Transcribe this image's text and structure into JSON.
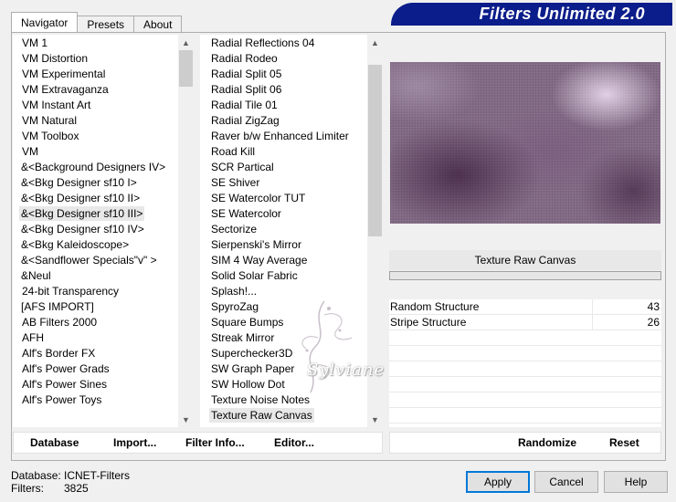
{
  "app_title": "Filters Unlimited 2.0",
  "tabs": [
    {
      "label": "Navigator",
      "active": true
    },
    {
      "label": "Presets",
      "active": false
    },
    {
      "label": "About",
      "active": false
    }
  ],
  "categories": [
    "VM 1",
    "VM Distortion",
    "VM Experimental",
    "VM Extravaganza",
    "VM Instant Art",
    "VM Natural",
    "VM Toolbox",
    "VM",
    "&<Background Designers IV>",
    "&<Bkg Designer sf10 I>",
    "&<Bkg Designer sf10 II>",
    "&<Bkg Designer sf10 III>",
    "&<Bkg Designer sf10 IV>",
    "&<Bkg Kaleidoscope>",
    "&<Sandflower Specials\"v\" >",
    "&Neul",
    "24-bit Transparency",
    "[AFS IMPORT]",
    "AB Filters 2000",
    "AFH",
    "Alf's Border FX",
    "Alf's Power Grads",
    "Alf's Power Sines",
    "Alf's Power Toys"
  ],
  "selected_category": "&<Bkg Designer sf10 III>",
  "filters": [
    "Radial Reflections 04",
    "Radial Rodeo",
    "Radial Split 05",
    "Radial Split 06",
    "Radial Tile 01",
    "Radial ZigZag",
    "Raver b/w Enhanced Limiter",
    "Road Kill",
    "SCR  Partical",
    "SE Shiver",
    "SE Watercolor TUT",
    "SE Watercolor",
    "Sectorize",
    "Sierpenski's Mirror",
    "SIM 4 Way Average",
    "Solid Solar Fabric",
    "Splash!...",
    "SpyroZag",
    "Square Bumps",
    "Streak Mirror",
    "Superchecker3D",
    "SW Graph Paper",
    "SW Hollow Dot",
    "Texture Noise Notes",
    "Texture Raw Canvas"
  ],
  "selected_filter": "Texture Raw Canvas",
  "current_filter_name": "Texture Raw Canvas",
  "progress": 0,
  "params": [
    {
      "name": "Random Structure",
      "value": "43"
    },
    {
      "name": "Stripe Structure",
      "value": "26"
    }
  ],
  "empty_param_rows": 6,
  "bottom_buttons": {
    "database": "Database",
    "import": "Import...",
    "filter_info": "Filter Info...",
    "editor": "Editor...",
    "randomize": "Randomize",
    "reset": "Reset"
  },
  "status": {
    "database_label": "Database:",
    "database_value": "ICNET-Filters",
    "filters_label": "Filters:",
    "filters_value": "3825"
  },
  "dialog_buttons": {
    "apply": "Apply",
    "cancel": "Cancel",
    "help": "Help"
  },
  "watermark_text": "Sylviane",
  "colors": {
    "banner": "#0b1d8a",
    "default_button_border": "#0078d7",
    "preview_base": "#826a85"
  },
  "icons": {
    "scroll_up": "▲",
    "scroll_down": "▼"
  }
}
